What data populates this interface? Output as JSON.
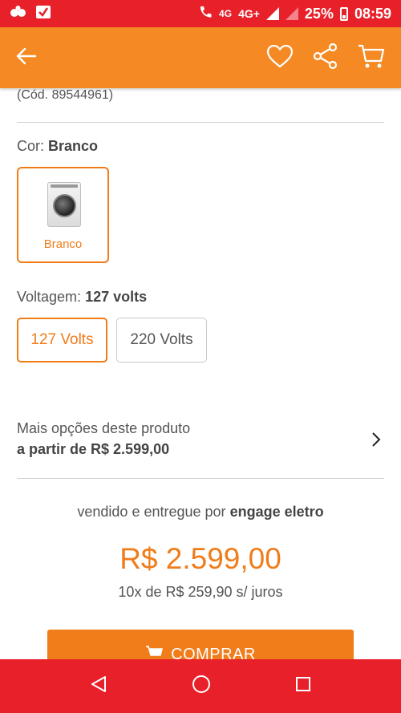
{
  "status_bar": {
    "network_primary": "4G",
    "network_secondary": "4G+",
    "battery_percent": "25%",
    "time": "08:59"
  },
  "app_bar": {
    "icons": [
      "back-arrow-icon",
      "heart-icon",
      "share-icon",
      "cart-icon"
    ]
  },
  "product": {
    "code": "(Cód. 89544961)",
    "color_label": "Cor:",
    "color_value": "Branco",
    "color_options": [
      {
        "name": "Branco",
        "selected": true
      }
    ],
    "voltage_label": "Voltagem:",
    "voltage_value": "127 volts",
    "voltage_options": [
      {
        "label": "127 Volts",
        "selected": true
      },
      {
        "label": "220 Volts",
        "selected": false
      }
    ]
  },
  "more_options": {
    "line1": "Mais opções deste produto",
    "line2": "a partir de R$ 2.599,00"
  },
  "seller": {
    "prefix": "vendido e entregue por",
    "name": "engage eletro"
  },
  "pricing": {
    "price": "R$ 2.599,00",
    "installments": "10x de R$ 259,90 s/ juros"
  },
  "buy_button": {
    "label": "COMPRAR"
  },
  "colors": {
    "status_bar": "#e8202a",
    "app_bar": "#f58a25",
    "accent": "#f07c1a",
    "nav_bar": "#e8202a"
  }
}
